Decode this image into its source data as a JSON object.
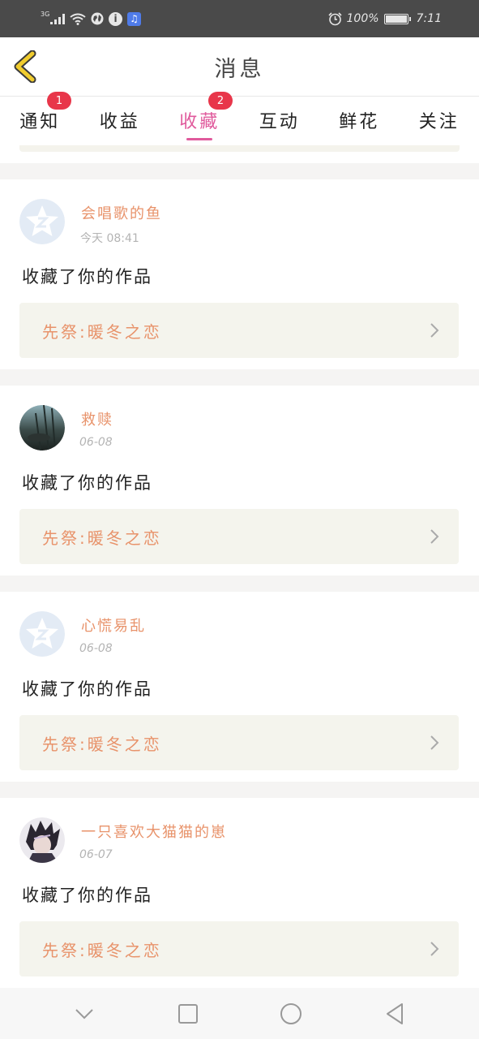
{
  "status_bar": {
    "network": "3G",
    "icons": [
      "signal-icon",
      "wifi-icon",
      "globe-icon",
      "info-icon",
      "music-icon"
    ],
    "battery_percent": "100%",
    "battery_level": 1.0,
    "time": "7:11"
  },
  "header": {
    "title": "消息",
    "back_icon": "chevron-left-icon"
  },
  "tabs": [
    {
      "label": "通知",
      "badge": "1",
      "active": false
    },
    {
      "label": "收益",
      "badge": "",
      "active": false
    },
    {
      "label": "收藏",
      "badge": "2",
      "active": true
    },
    {
      "label": "互动",
      "badge": "",
      "active": false
    },
    {
      "label": "鲜花",
      "badge": "",
      "active": false
    },
    {
      "label": "关注",
      "badge": "",
      "active": false
    }
  ],
  "messages": [
    {
      "user": "会唱歌的鱼",
      "time": "今天  08:41",
      "avatar": "default-avatar",
      "action": "收藏了你的作品",
      "work": "先祭:暖冬之恋"
    },
    {
      "user": "救赎",
      "time": "06-08",
      "avatar": "photo-avatar",
      "action": "收藏了你的作品",
      "work": "先祭:暖冬之恋"
    },
    {
      "user": "心慌易乱",
      "time": "06-08",
      "avatar": "default-avatar",
      "action": "收藏了你的作品",
      "work": "先祭:暖冬之恋"
    },
    {
      "user": "一只喜欢大猫猫的崽",
      "time": "06-07",
      "avatar": "anime-avatar",
      "action": "收藏了你的作品",
      "work": "先祭:暖冬之恋"
    }
  ],
  "nav": [
    "chevron-down-icon",
    "square-icon",
    "circle-icon",
    "triangle-back-icon"
  ],
  "colors": {
    "accent": "#e05a9c",
    "badge": "#e8364a",
    "name": "#e8936b",
    "back_arrow": "#f0cc2e"
  }
}
